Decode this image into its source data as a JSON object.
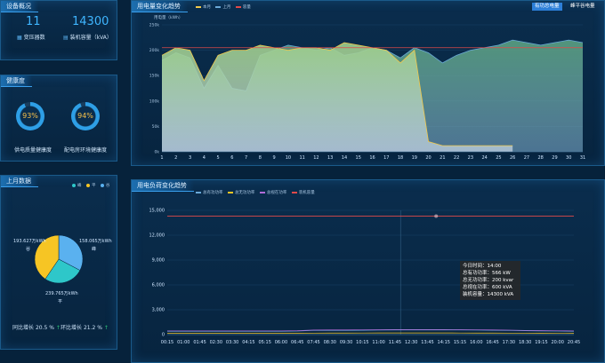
{
  "equipment": {
    "title": "设备概况",
    "transformers_value": "11",
    "transformers_label": "变压器数",
    "capacity_value": "14300",
    "capacity_label": "装机容量（kVA）"
  },
  "health": {
    "title": "健康度",
    "g1_value": "93%",
    "g1_label": "供电质量健康度",
    "g1_frac": 0.93,
    "g2_value": "94%",
    "g2_label": "配电房环境健康度",
    "g2_frac": 0.94
  },
  "monthly": {
    "title": "上月数据",
    "legend": [
      {
        "label": "峰",
        "color": "#2ec7c9"
      },
      {
        "label": "平",
        "color": "#f6c524"
      },
      {
        "label": "谷",
        "color": "#5ab1ef"
      }
    ],
    "pie": {
      "values": [
        193.627,
        158.065,
        239.765
      ],
      "colors": [
        "#5ab1ef",
        "#2ec7c9",
        "#f6c524"
      ],
      "labels": [
        {
          "value": "193.627万kWh",
          "name": "谷"
        },
        {
          "value": "158.065万kWh",
          "name": "峰"
        },
        {
          "value": "239.765万kWh",
          "name": "平"
        }
      ]
    },
    "yoy_label": "同比增长",
    "yoy_value": "20.5 %",
    "mom_label": "环比增长",
    "mom_value": "21.2 %",
    "arrow": "↑"
  },
  "energy_trend": {
    "title": "用电量变化趋势",
    "btn_active": "有功总电量",
    "btn_other": "峰平谷电量",
    "unit": "用电量（kWh）",
    "legend": [
      {
        "label": "本月",
        "color": "#f2c94c"
      },
      {
        "label": "上月",
        "color": "#6aa9d8"
      },
      {
        "label": "容量",
        "color": "#e04a4a"
      }
    ]
  },
  "load_trend": {
    "title": "用电负荷变化趋势",
    "legend": [
      {
        "label": "总有功功率",
        "color": "#6aa9d8"
      },
      {
        "label": "总无功功率",
        "color": "#f6c524"
      },
      {
        "label": "总视在功率",
        "color": "#b06cd8"
      },
      {
        "label": "装机容量",
        "color": "#e04a4a"
      }
    ]
  },
  "tooltip": {
    "time": "今日时间：14:00",
    "active": "总有功功率：566 kW",
    "reactive": "总无功功率：200 kvar",
    "apparent": "总视在功率：600 kVA",
    "capacity": "装机容量：14300 kVA"
  },
  "chart_data": [
    {
      "type": "area",
      "title": "用电量变化趋势",
      "ylabel": "用电量（kWh）",
      "x": [
        1,
        2,
        3,
        4,
        5,
        6,
        7,
        8,
        9,
        10,
        11,
        12,
        13,
        14,
        15,
        16,
        17,
        18,
        19,
        20,
        21,
        22,
        23,
        24,
        25,
        26,
        27,
        28,
        29,
        30,
        31
      ],
      "ylim": [
        0,
        250000
      ],
      "yticks": [
        "0k",
        "50k",
        "100k",
        "150k",
        "200k",
        "250k"
      ],
      "series": [
        {
          "name": "本月",
          "values": [
            190000,
            205000,
            200000,
            140000,
            190000,
            200000,
            200000,
            210000,
            205000,
            200000,
            205000,
            205000,
            200000,
            215000,
            210000,
            205000,
            200000,
            175000,
            200000,
            20000,
            12000,
            12000,
            12000,
            12000,
            12000,
            12000,
            null,
            null,
            null,
            null,
            null
          ]
        },
        {
          "name": "上月",
          "values": [
            180000,
            195000,
            185000,
            125000,
            170000,
            125000,
            120000,
            190000,
            200000,
            210000,
            205000,
            200000,
            205000,
            190000,
            195000,
            205000,
            200000,
            185000,
            205000,
            195000,
            175000,
            190000,
            200000,
            205000,
            210000,
            220000,
            215000,
            210000,
            215000,
            220000,
            215000
          ]
        },
        {
          "name": "容量",
          "values": [
            205000,
            205000,
            205000,
            205000,
            205000,
            205000,
            205000,
            205000,
            205000,
            205000,
            205000,
            205000,
            205000,
            205000,
            205000,
            205000,
            205000,
            205000,
            205000,
            205000,
            205000,
            205000,
            205000,
            205000,
            205000,
            205000,
            205000,
            205000,
            205000,
            205000,
            205000
          ]
        }
      ]
    },
    {
      "type": "line",
      "title": "用电负荷变化趋势",
      "categories": [
        "00:15",
        "01:00",
        "01:45",
        "02:30",
        "03:30",
        "04:15",
        "05:15",
        "06:00",
        "06:45",
        "07:45",
        "08:30",
        "09:30",
        "10:15",
        "11:00",
        "11:45",
        "12:30",
        "13:45",
        "14:15",
        "15:15",
        "16:00",
        "16:45",
        "17:30",
        "18:30",
        "19:15",
        "20:00",
        "20:45"
      ],
      "ylim": [
        0,
        15000
      ],
      "yticks": [
        "0",
        "3,000",
        "6,000",
        "9,000",
        "12,000",
        "15,000"
      ],
      "series": [
        {
          "name": "总有功功率",
          "values": [
            400,
            400,
            400,
            400,
            400,
            400,
            400,
            400,
            420,
            500,
            500,
            500,
            520,
            540,
            560,
            566,
            566,
            566,
            560,
            540,
            520,
            500,
            460,
            440,
            420,
            400
          ]
        },
        {
          "name": "总无功功率",
          "values": [
            150,
            150,
            150,
            150,
            150,
            150,
            150,
            150,
            160,
            180,
            190,
            190,
            195,
            200,
            200,
            200,
            200,
            200,
            195,
            190,
            185,
            180,
            170,
            160,
            155,
            150
          ]
        },
        {
          "name": "总视在功率",
          "values": [
            450,
            450,
            450,
            450,
            450,
            450,
            450,
            450,
            470,
            550,
            560,
            560,
            580,
            590,
            600,
            600,
            600,
            600,
            590,
            580,
            560,
            540,
            500,
            480,
            460,
            450
          ]
        },
        {
          "name": "装机容量",
          "values": [
            14300,
            14300,
            14300,
            14300,
            14300,
            14300,
            14300,
            14300,
            14300,
            14300,
            14300,
            14300,
            14300,
            14300,
            14300,
            14300,
            14300,
            14300,
            14300,
            14300,
            14300,
            14300,
            14300,
            14300,
            14300,
            14300
          ]
        }
      ]
    }
  ]
}
